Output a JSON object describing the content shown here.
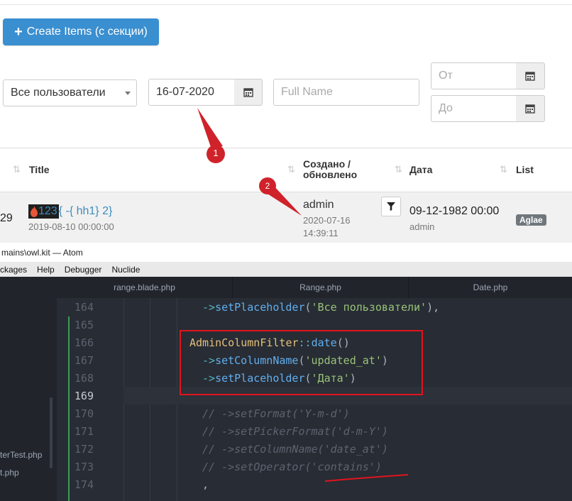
{
  "app": {
    "create_button_label": "Create Items (с секции)",
    "filters": {
      "users_select_value": "Все пользователи",
      "date_value": "16-07-2020",
      "fullname_placeholder": "Full Name",
      "from_placeholder": "От",
      "to_placeholder": "До"
    },
    "table": {
      "columns": [
        "Title",
        "Создано / обновлено",
        "Дата",
        "List"
      ],
      "row": {
        "id": "29",
        "title_link": "123",
        "title_rest": "{ -{ hh1} 2}",
        "title_date": "2019-08-10 00:00:00",
        "created_by": "admin",
        "created_date": "2020-07-16",
        "created_time": "14:39:11",
        "date": "09-12-1982 00:00",
        "date_by": "admin",
        "list_badge": "Aglae"
      }
    },
    "annotations": [
      "1",
      "2"
    ],
    "annotation_color": "#d0222a"
  },
  "atom": {
    "window_title": "mains\\owl.kit — Atom",
    "menu": [
      "ckages",
      "Help",
      "Debugger",
      "Nuclide"
    ],
    "tree_items": [
      "terTest.php",
      "t.php"
    ],
    "tabs": [
      "range.blade.php",
      "Range.php",
      "Date.php"
    ],
    "line_numbers": [
      "164",
      "165",
      "166",
      "167",
      "168",
      "169",
      "170",
      "171",
      "172",
      "173",
      "174"
    ],
    "code": {
      "l164_arrow": "->",
      "l164_fn": "setPlaceholder",
      "l164_open": "(",
      "l164_str": "'Все пользователи'",
      "l164_close": "),",
      "l166_cls": "AdminColumnFilter",
      "l166_op": "::",
      "l166_fn": "date",
      "l166_paren": "()",
      "l167_arrow": "->",
      "l167_fn": "setColumnName",
      "l167_open": "(",
      "l167_str": "'updated_at'",
      "l167_close": ")",
      "l168_arrow": "->",
      "l168_fn": "setPlaceholder",
      "l168_open": "(",
      "l168_str": "'Дата'",
      "l168_close": ")",
      "l170": "// ->setFormat('Y-m-d')",
      "l171": "// ->setPickerFormat('d-m-Y')",
      "l172": "// ->setColumnName('date_at')",
      "l173": "// ->setOperator('contains')",
      "l174": ","
    },
    "highlight_color": "#e0141e"
  }
}
